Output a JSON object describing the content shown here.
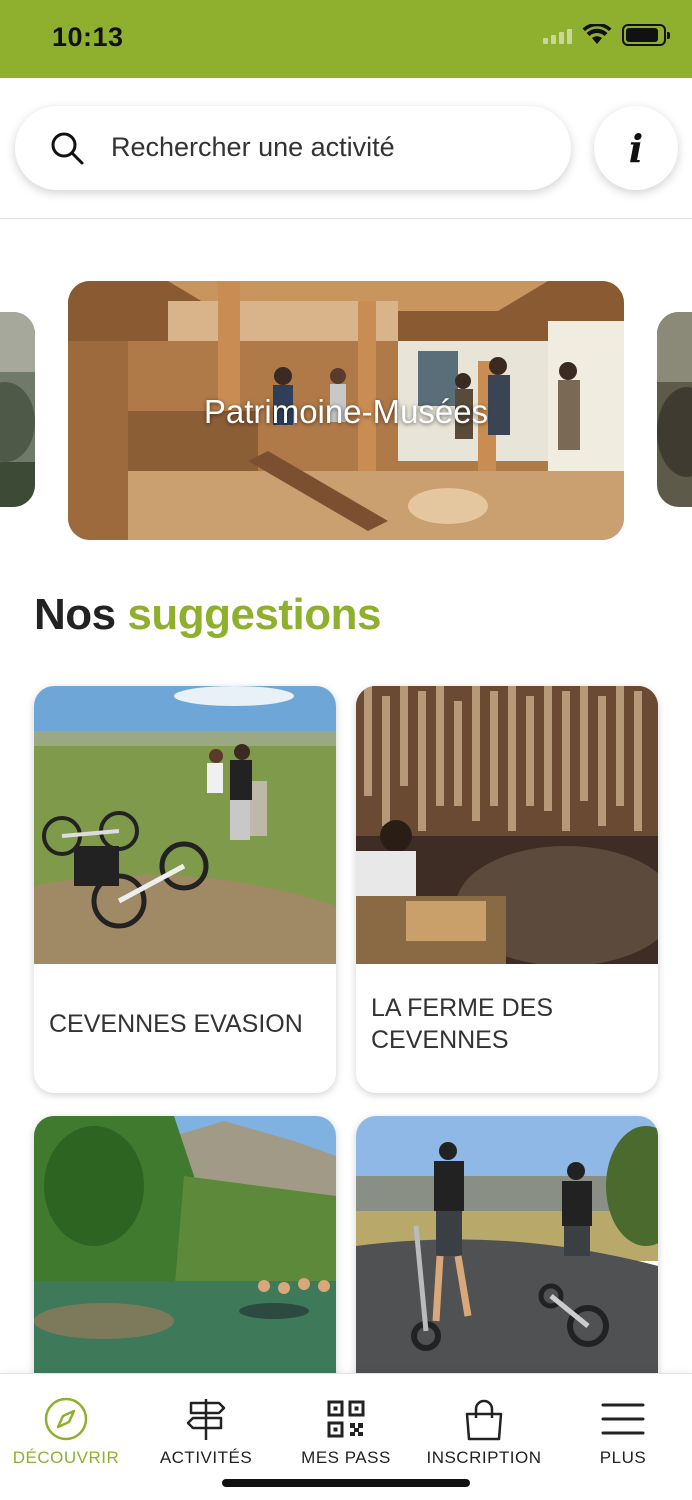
{
  "status_bar": {
    "time": "10:13",
    "battery_level": 0.9
  },
  "search": {
    "placeholder": "Rechercher une activité"
  },
  "info_button": {
    "glyph": "i"
  },
  "carousel": {
    "main_label": "Patrimoine-Musées"
  },
  "section": {
    "title_prefix": "Nos",
    "title_accent": "suggestions"
  },
  "suggestions": [
    {
      "title": "CEVENNES EVASION"
    },
    {
      "title": "LA FERME DES CEVENNES"
    },
    {
      "title": ""
    },
    {
      "title": ""
    }
  ],
  "tab_bar": {
    "tabs": [
      {
        "label": "DÉCOUVRIR",
        "icon": "compass-icon",
        "active": true
      },
      {
        "label": "ACTIVITÉS",
        "icon": "signpost-icon",
        "active": false
      },
      {
        "label": "MES PASS",
        "icon": "qr-code-icon",
        "active": false
      },
      {
        "label": "INSCRIPTION",
        "icon": "shopping-bag-icon",
        "active": false
      },
      {
        "label": "PLUS",
        "icon": "menu-icon",
        "active": false
      }
    ]
  },
  "colors": {
    "accent": "#8fb02f",
    "text": "#222222"
  }
}
